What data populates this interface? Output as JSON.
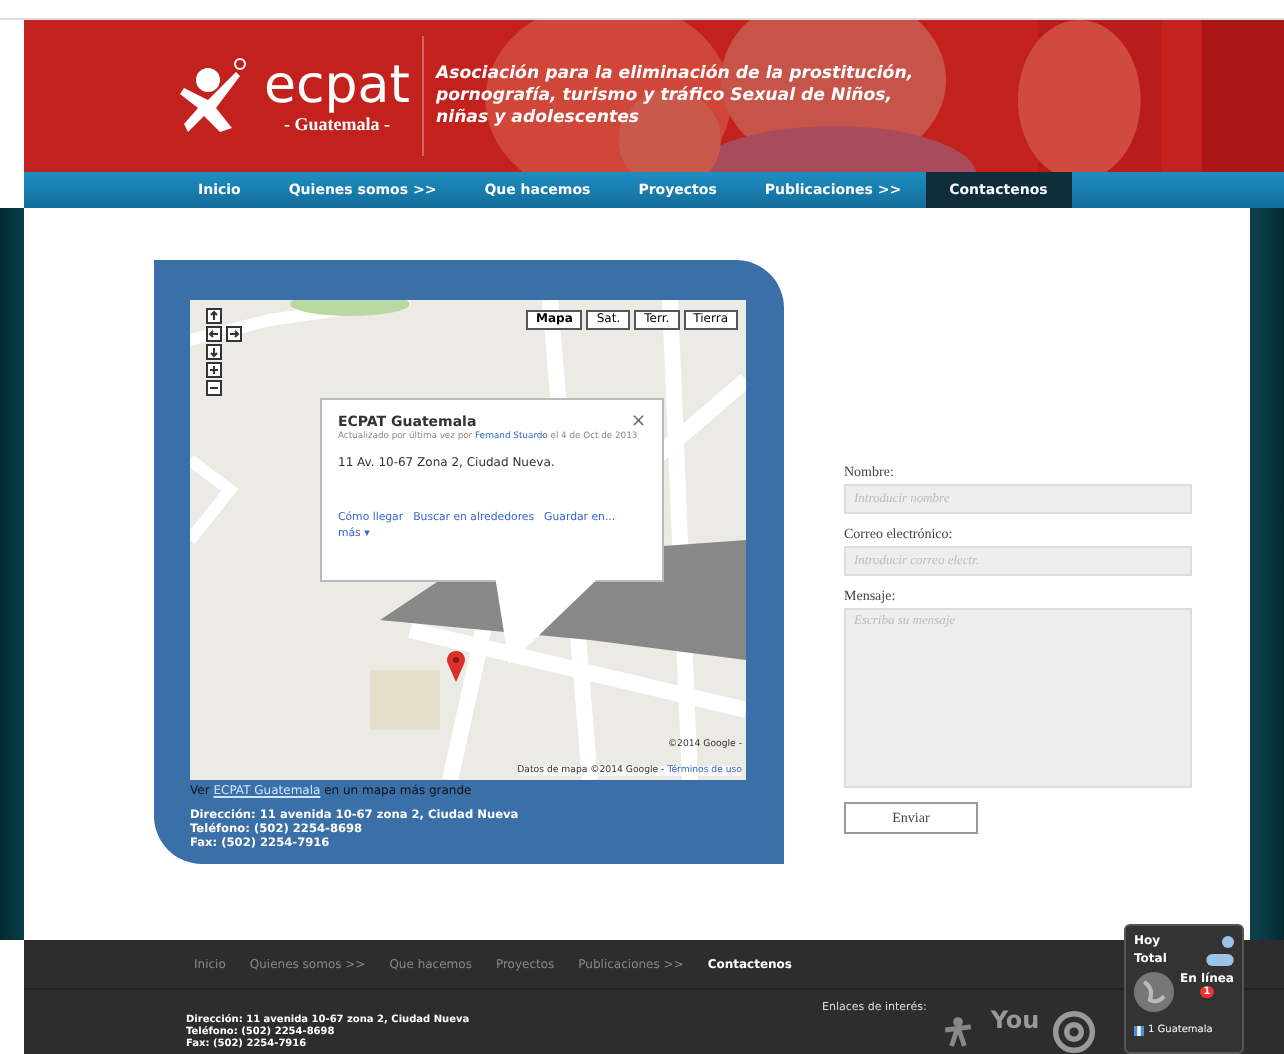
{
  "header": {
    "logo": "ecpat",
    "logo_sub": "- Guatemala -",
    "tagline": "Asociación para la eliminación de la prostitución, pornografía, turismo y tráfico Sexual de Niños, niñas y adolescentes"
  },
  "nav": [
    {
      "label": "Inicio",
      "selected": false
    },
    {
      "label": "Quienes somos >>",
      "selected": false
    },
    {
      "label": "Que hacemos",
      "selected": false
    },
    {
      "label": "Proyectos",
      "selected": false
    },
    {
      "label": "Publicaciones >>",
      "selected": false
    },
    {
      "label": "Contactenos",
      "selected": true
    }
  ],
  "map": {
    "map_types": [
      {
        "label": "Mapa",
        "selected": true
      },
      {
        "label": "Sat.",
        "selected": false
      },
      {
        "label": "Terr.",
        "selected": false
      },
      {
        "label": "Tierra",
        "selected": false
      }
    ],
    "info": {
      "title": "ECPAT Guatemala",
      "updated_prefix": "Actualizado por última vez por",
      "updated_author": "Fernand Stuardo",
      "updated_suffix": "el 4 de Oct de 2013",
      "address": "11 Av. 10-67 Zona 2, Ciudad Nueva.",
      "links": [
        "Cómo llegar",
        "Buscar en alrededores",
        "Guardar en...",
        "más ▾"
      ],
      "close": "×"
    },
    "copyright": "©2014 Google -",
    "attribution": "Datos de mapa ©2014 Google -",
    "terms": "Términos de uso",
    "view_prefix": "Ver",
    "view_link": "ECPAT Guatemala",
    "view_suffix": "en un mapa más grande"
  },
  "contact": [
    "Dirección: 11 avenida 10-67 zona 2, Ciudad Nueva",
    "Teléfono: (502) 2254-8698",
    "Fax:  (502) 2254-7916"
  ],
  "form": {
    "fields": [
      {
        "label": "Nombre:",
        "placeholder": "Introducir nombre",
        "kind": "input"
      },
      {
        "label": "Correo electrónico:",
        "placeholder": "Introducir correo electr.",
        "kind": "input"
      },
      {
        "label": "Mensaje:",
        "placeholder": "Escriba su mensaje",
        "kind": "textarea"
      }
    ],
    "submit": "Enviar"
  },
  "footer": {
    "nav": [
      {
        "label": "Inicio",
        "selected": false
      },
      {
        "label": "Quienes somos >>",
        "selected": false
      },
      {
        "label": "Que hacemos",
        "selected": false
      },
      {
        "label": "Proyectos",
        "selected": false
      },
      {
        "label": "Publicaciones >>",
        "selected": false
      },
      {
        "label": "Contactenos",
        "selected": true
      }
    ],
    "contact": [
      "Dirección: 11 avenida 10-67 zona 2, Ciudad Nueva",
      "Teléfono: (502) 2254-8698",
      "Fax:  (502) 2254-7916"
    ],
    "links_title": "Enlaces de interés:",
    "youtube": "You"
  },
  "widget": {
    "today": "Hoy",
    "total": "Total",
    "online": "En línea",
    "online_count": "1",
    "country": "1 Guatemala"
  }
}
